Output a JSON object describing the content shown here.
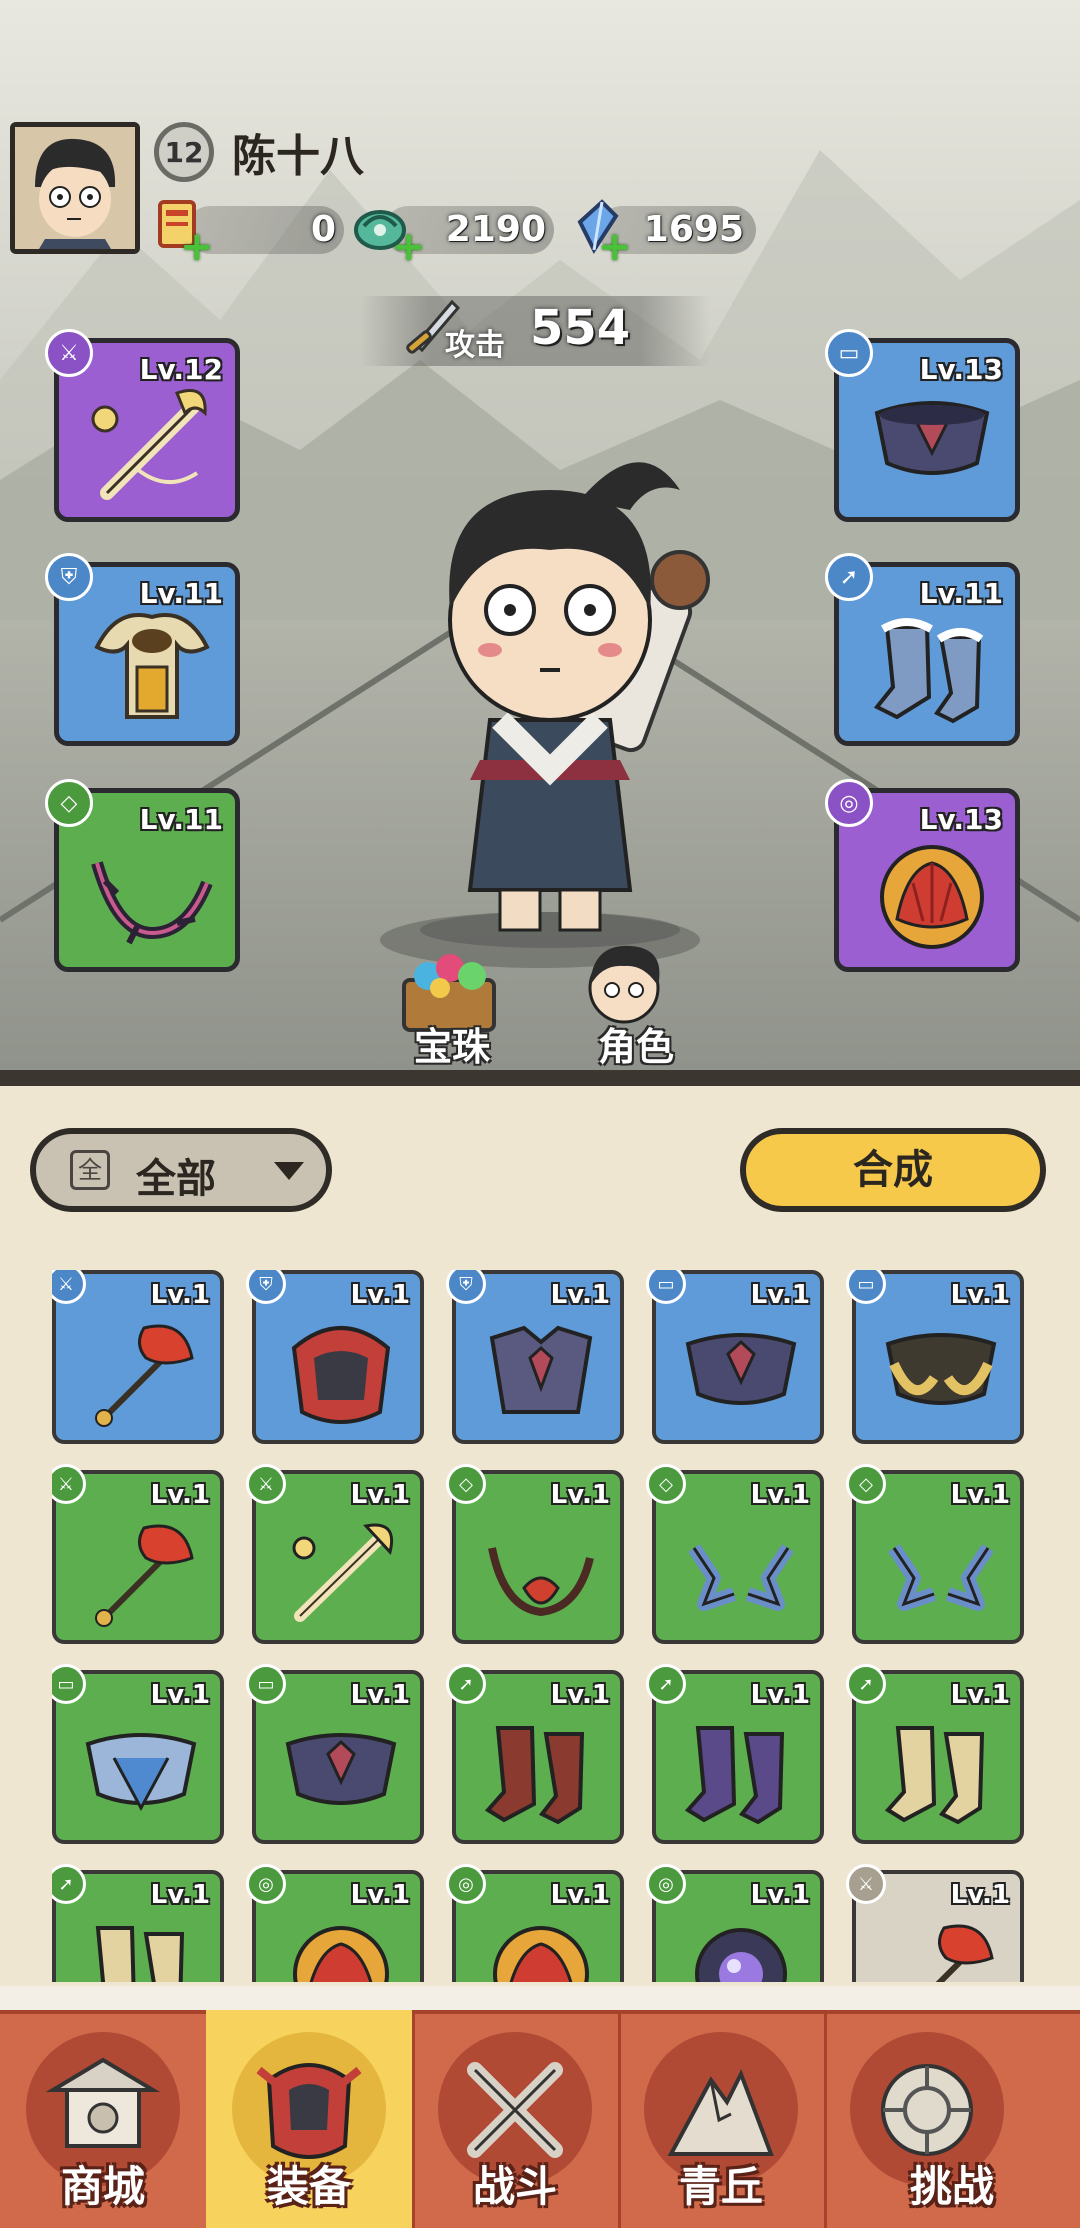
{
  "player": {
    "level": "12",
    "name": "陈十八"
  },
  "resources": [
    {
      "name": "scroll-ticket",
      "value": "0"
    },
    {
      "name": "jade-coin",
      "value": "2190"
    },
    {
      "name": "crystal",
      "value": "1695"
    }
  ],
  "attack": {
    "label": "攻击",
    "value": "554"
  },
  "equipped": {
    "weapon": {
      "level": "Lv.12",
      "rarity": "purple"
    },
    "helmet": {
      "level": "Lv.11",
      "rarity": "blue"
    },
    "necklace": {
      "level": "Lv.11",
      "rarity": "green"
    },
    "belt": {
      "level": "Lv.13",
      "rarity": "blue"
    },
    "boots": {
      "level": "Lv.11",
      "rarity": "blue"
    },
    "ring": {
      "level": "Lv.13",
      "rarity": "purple"
    }
  },
  "scene_buttons": {
    "gems": "宝珠",
    "character": "角色"
  },
  "filter": {
    "icon": "全",
    "label": "全部"
  },
  "synthesize_label": "合成",
  "inventory": [
    {
      "level": "Lv.1",
      "rarity": "blue",
      "slot": "weapon",
      "icon": "flower-staff"
    },
    {
      "level": "Lv.1",
      "rarity": "blue",
      "slot": "helmet",
      "icon": "red-mask"
    },
    {
      "level": "Lv.1",
      "rarity": "blue",
      "slot": "helmet",
      "icon": "dark-armor"
    },
    {
      "level": "Lv.1",
      "rarity": "blue",
      "slot": "belt",
      "icon": "dark-belt"
    },
    {
      "level": "Lv.1",
      "rarity": "blue",
      "slot": "belt",
      "icon": "gold-belt"
    },
    {
      "level": "Lv.1",
      "rarity": "green",
      "slot": "weapon",
      "icon": "flower-staff"
    },
    {
      "level": "Lv.1",
      "rarity": "green",
      "slot": "weapon",
      "icon": "golden-staff"
    },
    {
      "level": "Lv.1",
      "rarity": "green",
      "slot": "necklace",
      "icon": "red-necklace"
    },
    {
      "level": "Lv.1",
      "rarity": "green",
      "slot": "necklace",
      "icon": "blue-necklace"
    },
    {
      "level": "Lv.1",
      "rarity": "green",
      "slot": "necklace",
      "icon": "blue-necklace"
    },
    {
      "level": "Lv.1",
      "rarity": "green",
      "slot": "belt",
      "icon": "ice-belt"
    },
    {
      "level": "Lv.1",
      "rarity": "green",
      "slot": "belt",
      "icon": "dark-belt"
    },
    {
      "level": "Lv.1",
      "rarity": "green",
      "slot": "boots",
      "icon": "red-boots"
    },
    {
      "level": "Lv.1",
      "rarity": "green",
      "slot": "boots",
      "icon": "purple-boots"
    },
    {
      "level": "Lv.1",
      "rarity": "green",
      "slot": "boots",
      "icon": "gold-boots"
    },
    {
      "level": "Lv.1",
      "rarity": "green",
      "slot": "boots",
      "icon": "gold-boots"
    },
    {
      "level": "Lv.1",
      "rarity": "green",
      "slot": "ring",
      "icon": "lotus-ring"
    },
    {
      "level": "Lv.1",
      "rarity": "green",
      "slot": "ring",
      "icon": "lotus-ring"
    },
    {
      "level": "Lv.1",
      "rarity": "green",
      "slot": "ring",
      "icon": "orb-ring"
    },
    {
      "level": "Lv.1",
      "rarity": "gray",
      "slot": "weapon",
      "icon": "flower-staff"
    }
  ],
  "nav": [
    {
      "label": "商城",
      "icon": "shop-icon",
      "active": false
    },
    {
      "label": "装备",
      "icon": "equipment-icon",
      "active": true
    },
    {
      "label": "战斗",
      "icon": "battle-icon",
      "active": false
    },
    {
      "label": "青丘",
      "icon": "mountain-icon",
      "active": false
    },
    {
      "label": "挑战",
      "icon": "challenge-icon",
      "active": false
    }
  ],
  "colors": {
    "purple": "#9b5fd1",
    "blue": "#5f9bd8",
    "green": "#5cae4e",
    "gray": "#d9d3c6",
    "accent_yellow": "#f7c94a",
    "nav_red": "#d06a4a"
  }
}
